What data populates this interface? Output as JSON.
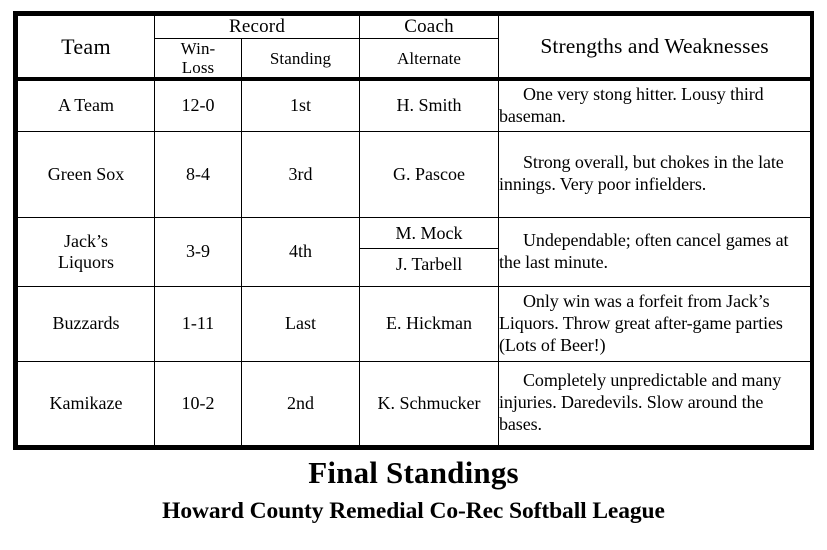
{
  "table": {
    "headers": {
      "team": "Team",
      "record_group": "Record",
      "win_loss": "Win-\nLoss",
      "win_loss_line1": "Win-",
      "win_loss_line2": "Loss",
      "standing": "Standing",
      "coach_group": "Coach",
      "alternate": "Alternate",
      "strengths": "Strengths and Weaknesses"
    },
    "rows": [
      {
        "team": "A Team",
        "win_loss": "12-0",
        "standing": "1st",
        "coaches": [
          "H. Smith"
        ],
        "notes": "One very stong hitter. Lousy third baseman."
      },
      {
        "team": "Green Sox",
        "win_loss": "8-4",
        "standing": "3rd",
        "coaches": [
          "G. Pascoe"
        ],
        "notes": "Strong overall, but chokes in the late innings.  Very poor infielders."
      },
      {
        "team": "Jack’s Liquors",
        "win_loss": "3-9",
        "standing": "4th",
        "coaches": [
          "M. Mock",
          "J. Tarbell"
        ],
        "notes": "Undependable; often cancel games at the last minute."
      },
      {
        "team": "Buzzards",
        "win_loss": "1-11",
        "standing": "Last",
        "coaches": [
          "E. Hickman"
        ],
        "notes": "Only win was a forfeit from Jack’s Liquors.  Throw great after-game parties (Lots of Beer!)"
      },
      {
        "team": "Kamikaze",
        "win_loss": "10-2",
        "standing": "2nd",
        "coaches": [
          "K. Schmucker"
        ],
        "notes": "Completely unpredictable and many injuries.  Daredevils.  Slow around the bases."
      }
    ]
  },
  "caption": {
    "title": "Final Standings",
    "subtitle": "Howard County Remedial Co-Rec Softball League"
  },
  "colors": {
    "ink": "#000000",
    "paper": "#ffffff"
  }
}
